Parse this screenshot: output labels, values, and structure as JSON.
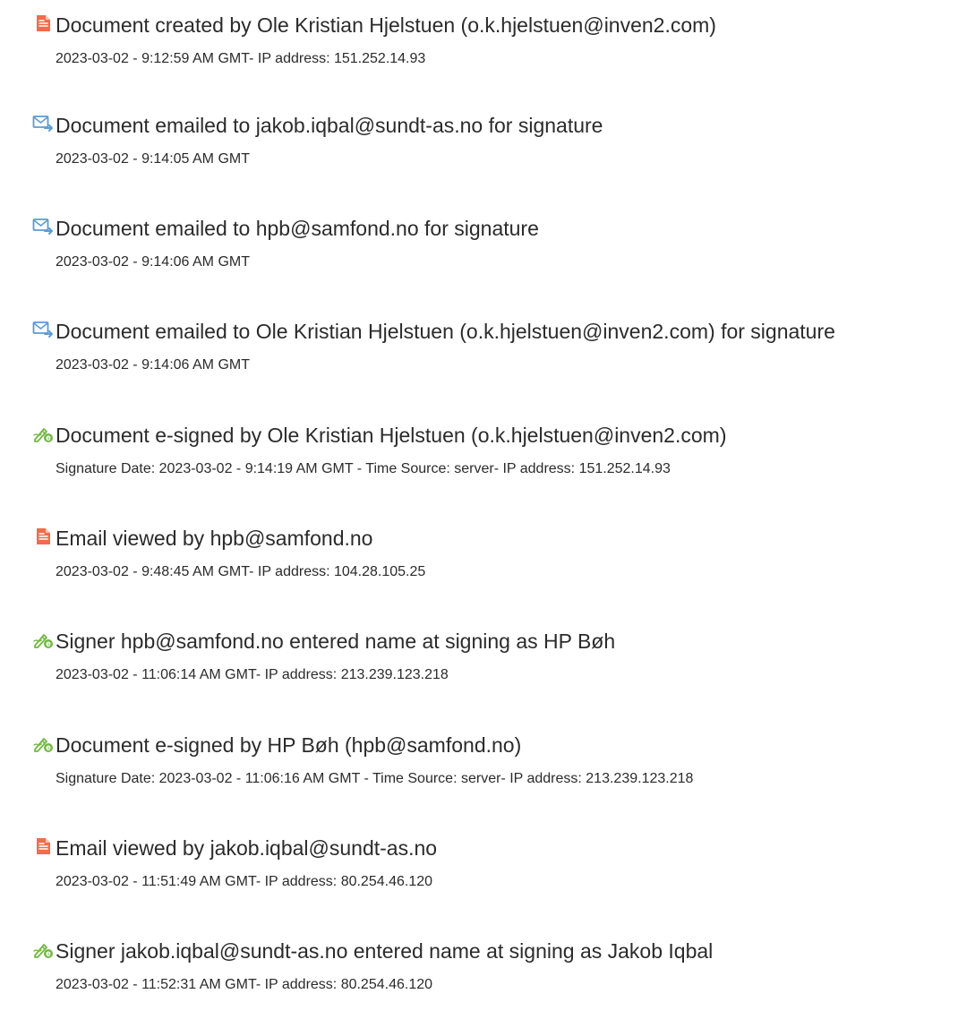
{
  "events": [
    {
      "icon": "document-pdf-icon",
      "title": "Document created by Ole Kristian Hjelstuen (o.k.hjelstuen@inven2.com)",
      "detail": "2023-03-02 - 9:12:59 AM GMT- IP address: 151.252.14.93"
    },
    {
      "icon": "email-sent-icon",
      "title": "Document emailed to jakob.iqbal@sundt-as.no for signature",
      "detail": "2023-03-02 - 9:14:05 AM GMT"
    },
    {
      "icon": "email-sent-icon",
      "title": "Document emailed to hpb@samfond.no for signature",
      "detail": "2023-03-02 - 9:14:06 AM GMT"
    },
    {
      "icon": "email-sent-icon",
      "title": "Document emailed to Ole Kristian Hjelstuen (o.k.hjelstuen@inven2.com) for signature",
      "detail": "2023-03-02 - 9:14:06 AM GMT"
    },
    {
      "icon": "e-sign-icon",
      "title": "Document e-signed by Ole Kristian Hjelstuen (o.k.hjelstuen@inven2.com)",
      "detail": "Signature Date: 2023-03-02 - 9:14:19 AM GMT - Time Source: server- IP address: 151.252.14.93"
    },
    {
      "icon": "document-pdf-icon",
      "title": "Email viewed by hpb@samfond.no",
      "detail": "2023-03-02 - 9:48:45 AM GMT- IP address: 104.28.105.25"
    },
    {
      "icon": "e-sign-icon",
      "title": "Signer hpb@samfond.no entered name at signing as HP Bøh",
      "detail": "2023-03-02 - 11:06:14 AM GMT- IP address: 213.239.123.218"
    },
    {
      "icon": "e-sign-icon",
      "title": "Document e-signed by HP Bøh (hpb@samfond.no)",
      "detail": "Signature Date: 2023-03-02 - 11:06:16 AM GMT - Time Source: server- IP address: 213.239.123.218"
    },
    {
      "icon": "document-pdf-icon",
      "title": "Email viewed by jakob.iqbal@sundt-as.no",
      "detail": "2023-03-02 - 11:51:49 AM GMT- IP address: 80.254.46.120"
    },
    {
      "icon": "e-sign-icon",
      "title": "Signer jakob.iqbal@sundt-as.no entered name at signing as Jakob Iqbal",
      "detail": "2023-03-02 - 11:52:31 AM GMT- IP address: 80.254.46.120"
    }
  ],
  "colors": {
    "pdf_icon": "#f26b4a",
    "email_icon": "#5b9bd5",
    "sign_icon": "#73b843",
    "text": "#2b2b2b"
  }
}
